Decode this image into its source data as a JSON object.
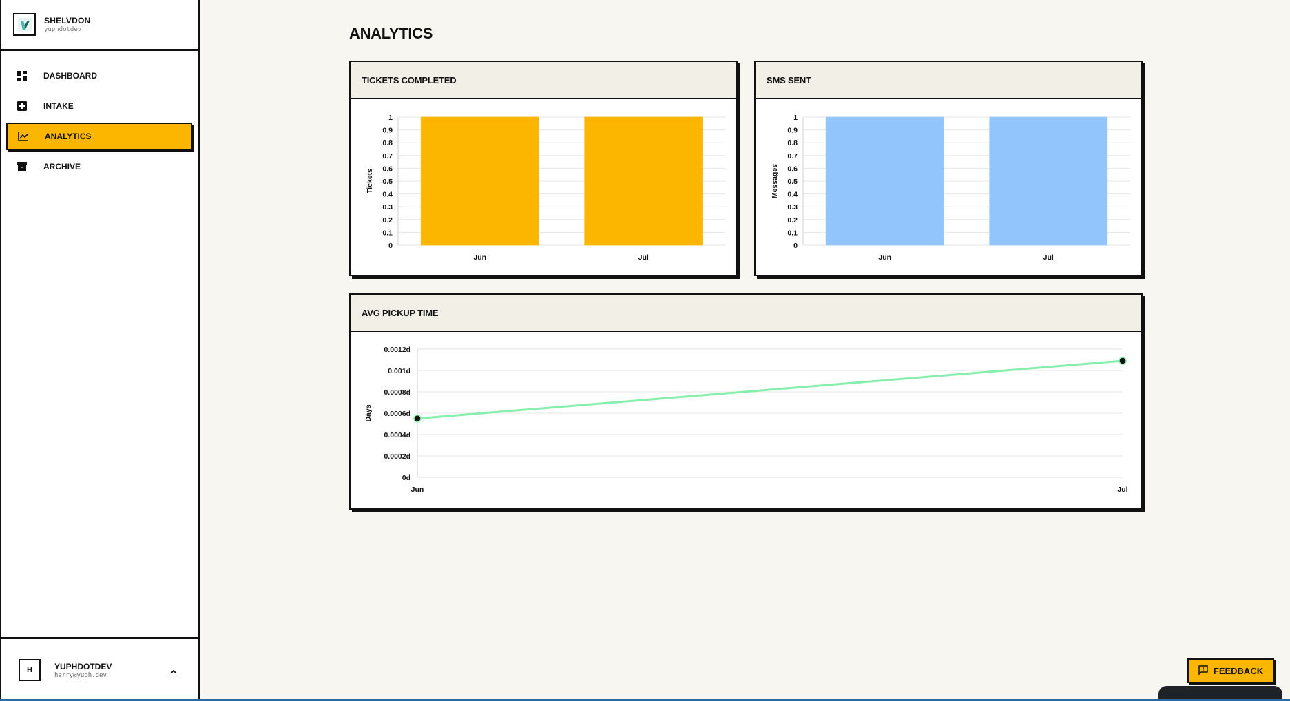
{
  "brand": {
    "name": "SHELVDON",
    "subtitle": "yuphdotdev"
  },
  "nav": {
    "items": [
      {
        "label": "DASHBOARD",
        "icon": "dashboard-icon",
        "active": false
      },
      {
        "label": "INTAKE",
        "icon": "add-box-icon",
        "active": false
      },
      {
        "label": "ANALYTICS",
        "icon": "chart-line-icon",
        "active": true
      },
      {
        "label": "ARCHIVE",
        "icon": "archive-icon",
        "active": false
      }
    ]
  },
  "user": {
    "initial": "H",
    "name": "YUPHDOTDEV",
    "email": "harry@yuph.dev"
  },
  "page": {
    "title": "ANALYTICS"
  },
  "colors": {
    "accent": "#fdb600",
    "sms_bar": "#93c5fd",
    "pickup_line": "#86efac",
    "background": "#f8f6f0"
  },
  "cards": {
    "tickets": {
      "title": "TICKETS COMPLETED"
    },
    "sms": {
      "title": "SMS SENT"
    },
    "pickup": {
      "title": "AVG PICKUP TIME"
    }
  },
  "feedback": {
    "label": "FEEDBACK",
    "icon": "feedback-icon"
  },
  "chart_data": [
    {
      "type": "bar",
      "title": "TICKETS COMPLETED",
      "categories": [
        "Jun",
        "Jul"
      ],
      "values": [
        1,
        1
      ],
      "xlabel": "",
      "ylabel": "Tickets",
      "ylim": [
        0,
        1
      ],
      "yticks": [
        "0",
        "0.1",
        "0.2",
        "0.3",
        "0.4",
        "0.5",
        "0.6",
        "0.7",
        "0.8",
        "0.9",
        "1"
      ],
      "color": "#fdb600",
      "grid": true
    },
    {
      "type": "bar",
      "title": "SMS SENT",
      "categories": [
        "Jun",
        "Jul"
      ],
      "values": [
        1,
        1
      ],
      "xlabel": "",
      "ylabel": "Messages",
      "ylim": [
        0,
        1
      ],
      "yticks": [
        "0",
        "0.1",
        "0.2",
        "0.3",
        "0.4",
        "0.5",
        "0.6",
        "0.7",
        "0.8",
        "0.9",
        "1"
      ],
      "color": "#93c5fd",
      "grid": true
    },
    {
      "type": "line",
      "title": "AVG PICKUP TIME",
      "x": [
        "Jun",
        "Jul"
      ],
      "values": [
        0.00055,
        0.00109
      ],
      "xlabel": "",
      "ylabel": "Days",
      "ylim": [
        0,
        0.0012
      ],
      "yticks": [
        "0d",
        "0.0002d",
        "0.0004d",
        "0.0006d",
        "0.0008d",
        "0.001d",
        "0.0012d"
      ],
      "color": "#86efac",
      "grid": true
    }
  ]
}
